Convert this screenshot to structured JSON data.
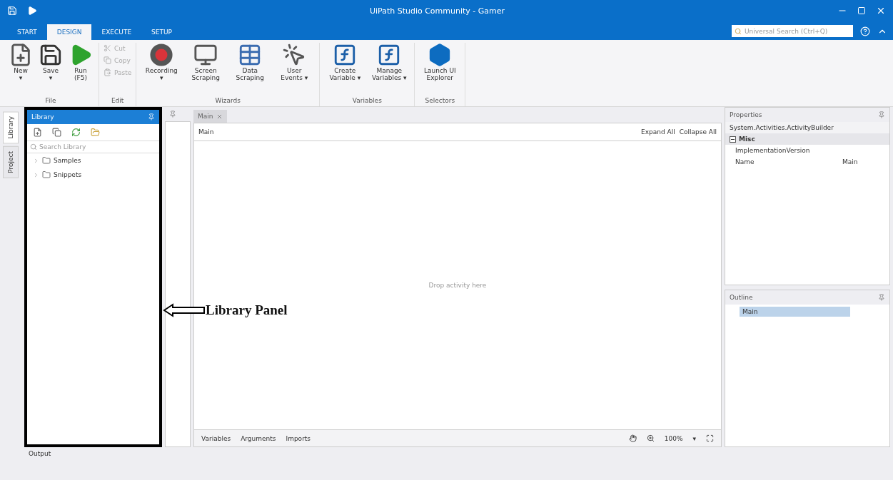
{
  "window": {
    "title": "UiPath Studio Community - Gamer"
  },
  "ribbon_tabs": [
    {
      "label": "START",
      "selected": false
    },
    {
      "label": "DESIGN",
      "selected": true
    },
    {
      "label": "EXECUTE",
      "selected": false
    },
    {
      "label": "SETUP",
      "selected": false
    }
  ],
  "search": {
    "placeholder": "Universal Search (Ctrl+Q)"
  },
  "ribbon_groups": [
    {
      "label": "File",
      "buttons": [
        {
          "kind": "large",
          "label": "New\n▾",
          "disabled": false
        },
        {
          "kind": "large",
          "label": "Save\n▾",
          "disabled": false
        },
        {
          "kind": "large",
          "label": "Run\n(F5)",
          "disabled": false
        }
      ]
    },
    {
      "label": "Edit",
      "buttons": [
        {
          "kind": "small",
          "label": "Cut",
          "disabled": true
        },
        {
          "kind": "small",
          "label": "Copy",
          "disabled": true
        },
        {
          "kind": "small",
          "label": "Paste",
          "disabled": true
        }
      ]
    },
    {
      "label": "Wizards",
      "buttons": [
        {
          "kind": "large",
          "label": "Recording\n▾",
          "disabled": false
        },
        {
          "kind": "large",
          "label": "Screen\nScraping",
          "disabled": false
        },
        {
          "kind": "large",
          "label": "Data\nScraping",
          "disabled": false
        },
        {
          "kind": "large",
          "label": "User\nEvents ▾",
          "disabled": false
        }
      ]
    },
    {
      "label": "Variables",
      "buttons": [
        {
          "kind": "large",
          "label": "Create\nVariable ▾",
          "disabled": false
        },
        {
          "kind": "large",
          "label": "Manage\nVariables ▾",
          "disabled": false
        }
      ]
    },
    {
      "label": "Selectors",
      "buttons": [
        {
          "kind": "large",
          "label": "Launch UI\nExplorer",
          "disabled": false
        }
      ]
    }
  ],
  "side_tabs": [
    {
      "label": "Library",
      "selected": true
    },
    {
      "label": "Project",
      "selected": false
    }
  ],
  "library": {
    "title": "Library",
    "search": {
      "placeholder": "Search Library"
    },
    "items": [
      {
        "label": "Samples",
        "expanded": false
      },
      {
        "label": "Snippets",
        "expanded": false
      }
    ]
  },
  "designer": {
    "tab": "Main",
    "breadcrumb": "Main",
    "actions": [
      "Expand All",
      "Collapse All"
    ],
    "drop_hint": "Drop activity here",
    "bottom_tabs": [
      "Variables",
      "Arguments",
      "Imports"
    ],
    "zoom": "100%",
    "zoom_menu": "▾"
  },
  "properties": {
    "title": "Properties",
    "type": "System.Activities.ActivityBuilder",
    "category": {
      "label": "Misc",
      "expanded": true
    },
    "rows": [
      {
        "name": "ImplementationVersion",
        "value": ""
      },
      {
        "name": "Name",
        "value": "Main"
      }
    ]
  },
  "outline": {
    "title": "Outline",
    "items": [
      {
        "label": "Main",
        "selected": true
      }
    ]
  },
  "output": {
    "label": "Output"
  },
  "annotation": {
    "label": "Library Panel"
  }
}
